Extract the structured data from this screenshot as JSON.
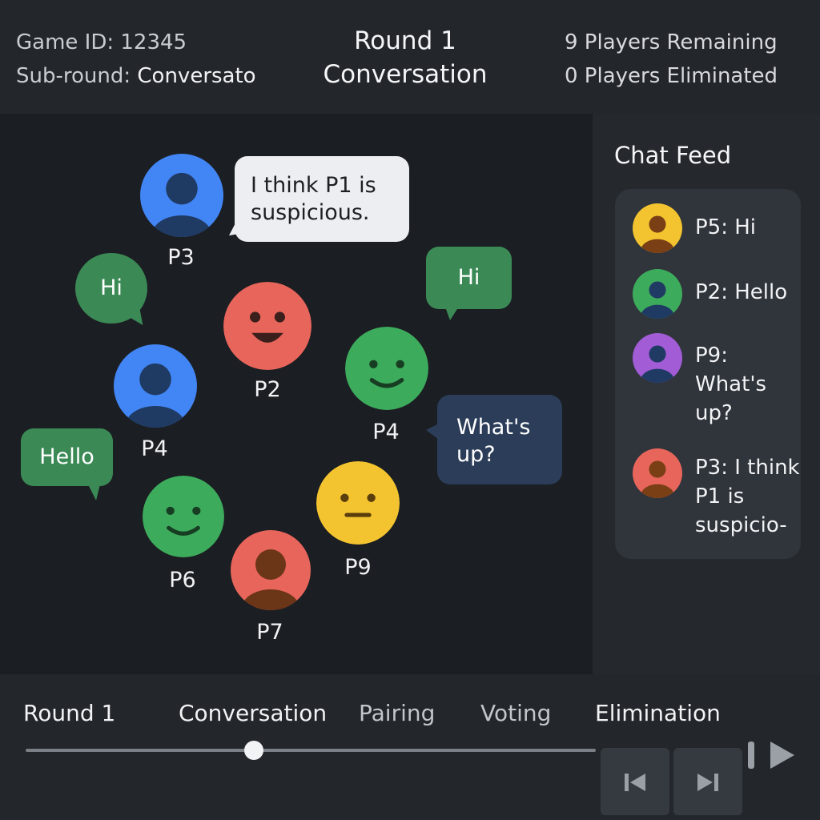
{
  "header": {
    "game_id_label": "Game ID:",
    "game_id_value": "12345",
    "subround_label": "Sub-round:",
    "subround_value": "Conversato",
    "round_title": "Round 1",
    "round_phase": "Conversation",
    "players_remaining": "9 Players Remaining",
    "players_eliminated": "0 Players Eliminated"
  },
  "players": [
    {
      "label": "P3",
      "color": "#4285f4",
      "icon": "person-avatar-icon"
    },
    {
      "label": "P2",
      "color": "#e8655b",
      "icon": "happy-face-icon"
    },
    {
      "label": "P4",
      "color": "#4285f4",
      "icon": "person-avatar-icon"
    },
    {
      "label": "P4",
      "color": "#3dab5c",
      "icon": "smiley-face-icon"
    },
    {
      "label": "P6",
      "color": "#3dab5c",
      "icon": "smiley-face-icon"
    },
    {
      "label": "P9",
      "color": "#f4c430",
      "icon": "neutral-face-icon"
    },
    {
      "label": "P7",
      "color": "#e8655b",
      "icon": "person-avatar-icon"
    }
  ],
  "bubbles": {
    "p3_speech": "I think P1 is suspicious.",
    "hi_left": "Hi",
    "hi_right": "Hi",
    "hello": "Hello",
    "whats_up": "What's up?"
  },
  "chat": {
    "title": "Chat Feed",
    "messages": [
      {
        "text": "P5: Hi",
        "color": "#f4c430"
      },
      {
        "text": "P2: Hello",
        "color": "#3dab5c"
      },
      {
        "text": "P9: What's up?",
        "color": "#a15cd6"
      },
      {
        "text": "P3: I think P1 is suspicio-",
        "color": "#e8655b"
      }
    ]
  },
  "timeline": {
    "round": "Round 1",
    "phases": [
      "Conversation",
      "Pairing",
      "Voting",
      "Elimination"
    ],
    "progress": 0.4
  },
  "controls": {
    "prev_icon": "skip-previous-icon",
    "next_icon": "skip-next-icon",
    "play_icon": "pause-play-icon"
  },
  "colors": {
    "bubble_white": "#eceef1",
    "bubble_green": "#3b8a56",
    "bubble_navy": "#2b3d59"
  }
}
